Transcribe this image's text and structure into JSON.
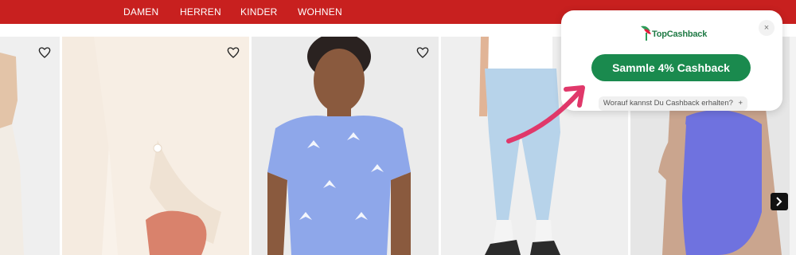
{
  "nav": {
    "items": [
      {
        "label": "DAMEN"
      },
      {
        "label": "HERREN"
      },
      {
        "label": "KINDER"
      },
      {
        "label": "WOHNEN"
      }
    ]
  },
  "popup": {
    "brand": "TopCashback",
    "cta_label": "Sammle 4% Cashback",
    "help_text": "Worauf kannst Du Cashback erhalten?",
    "help_icon": "+",
    "close_icon": "×"
  },
  "colors": {
    "nav_bg": "#c8201f",
    "cta_bg": "#1a8a4e",
    "arrow": "#e0386a"
  },
  "icons": [
    "heart-icon",
    "chevron-right-icon",
    "close-icon",
    "arrow-icon",
    "plus-icon"
  ]
}
